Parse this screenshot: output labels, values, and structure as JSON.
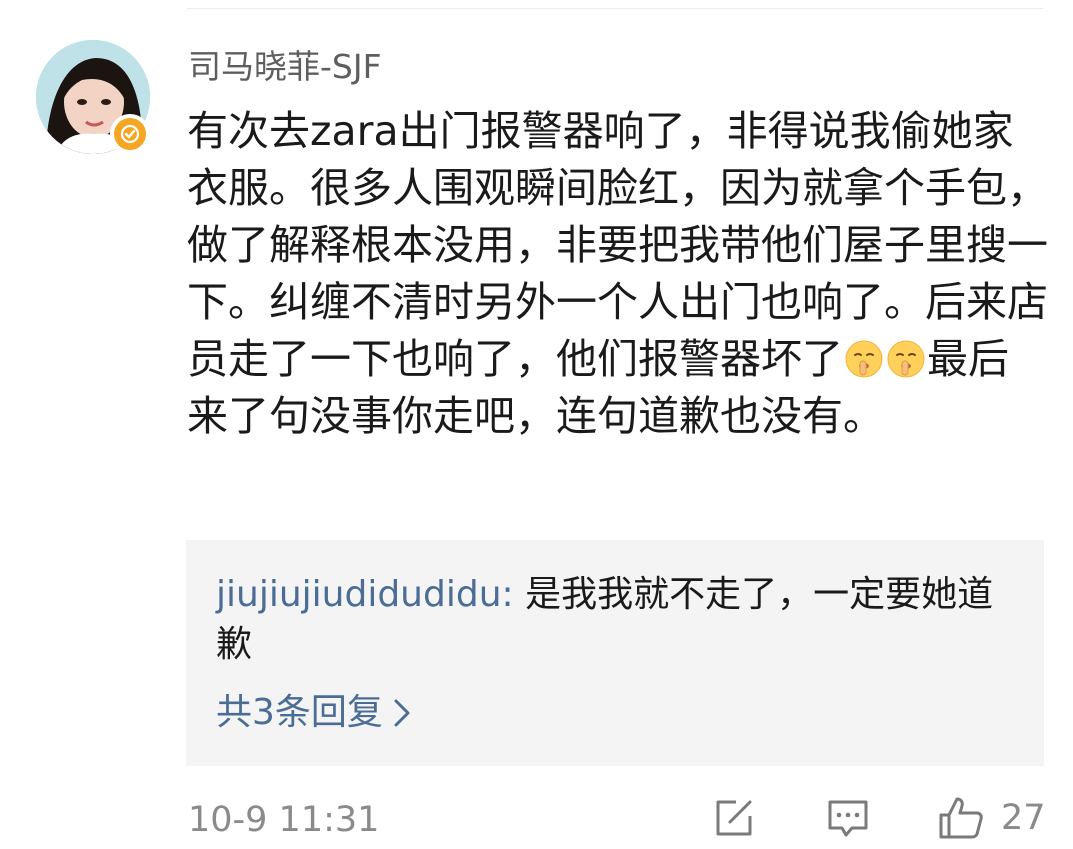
{
  "comment": {
    "username": "司马晓菲-SJF",
    "avatar_icon": "user-avatar",
    "verified_icon": "verified-badge-icon",
    "badge_color": "#f5a623",
    "text_part1": "有次去zara出门报警器响了，非得说我偷她家衣服。很多人围观瞬间脸红，因为就拿个手包，做了解释根本没用，非要把我带他们屋子里搜一下。纠缠不清时另外一个人出门也响了。后来店员走了一下也响了，他们报警器坏了",
    "emoji_name": "shushing-face-emoji",
    "text_part2": "最后来了句没事你走吧，连句道歉也没有。",
    "timestamp": "10-9 11:31",
    "like_count": "27"
  },
  "reply": {
    "user": "jiujiujiudidudidu",
    "separator": ": ",
    "text": "是我我就不走了，一定要她道歉",
    "more_replies": "共3条回复",
    "link_color": "#4b6d95"
  },
  "actions": {
    "share_icon": "share-icon",
    "comment_icon": "comment-icon",
    "like_icon": "thumbs-up-icon"
  }
}
